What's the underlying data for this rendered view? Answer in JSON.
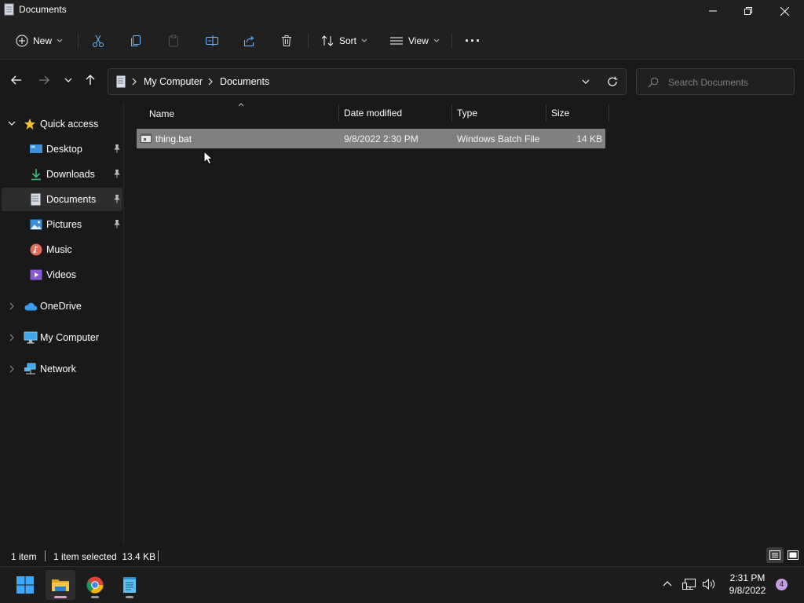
{
  "window": {
    "title": "Documents"
  },
  "toolbar": {
    "new_label": "New",
    "sort_label": "Sort",
    "view_label": "View",
    "more_label": "···"
  },
  "address": {
    "segments": [
      "My Computer",
      "Documents"
    ],
    "search_placeholder": "Search Documents"
  },
  "sidebar": {
    "quick_access": "Quick access",
    "items": [
      {
        "label": "Desktop",
        "pinned": true
      },
      {
        "label": "Downloads",
        "pinned": true
      },
      {
        "label": "Documents",
        "pinned": true,
        "selected": true
      },
      {
        "label": "Pictures",
        "pinned": true
      },
      {
        "label": "Music",
        "pinned": false
      },
      {
        "label": "Videos",
        "pinned": false
      }
    ],
    "roots": [
      {
        "label": "OneDrive"
      },
      {
        "label": "My Computer"
      },
      {
        "label": "Network"
      }
    ]
  },
  "columns": [
    "Name",
    "Date modified",
    "Type",
    "Size"
  ],
  "files": [
    {
      "name": "thing.bat",
      "date": "9/8/2022 2:30 PM",
      "type": "Windows Batch File",
      "size": "14 KB",
      "selected": true
    }
  ],
  "status": {
    "count": "1 item",
    "selection": "1 item selected  13.4 KB"
  },
  "taskbar": {
    "time": "2:31 PM",
    "date": "9/8/2022",
    "notification_count": "4"
  },
  "colors": {
    "window_bg": "#191919",
    "chrome_bg": "#202020",
    "selected_row": "#808080",
    "notification_badge": "#c59ee8"
  }
}
